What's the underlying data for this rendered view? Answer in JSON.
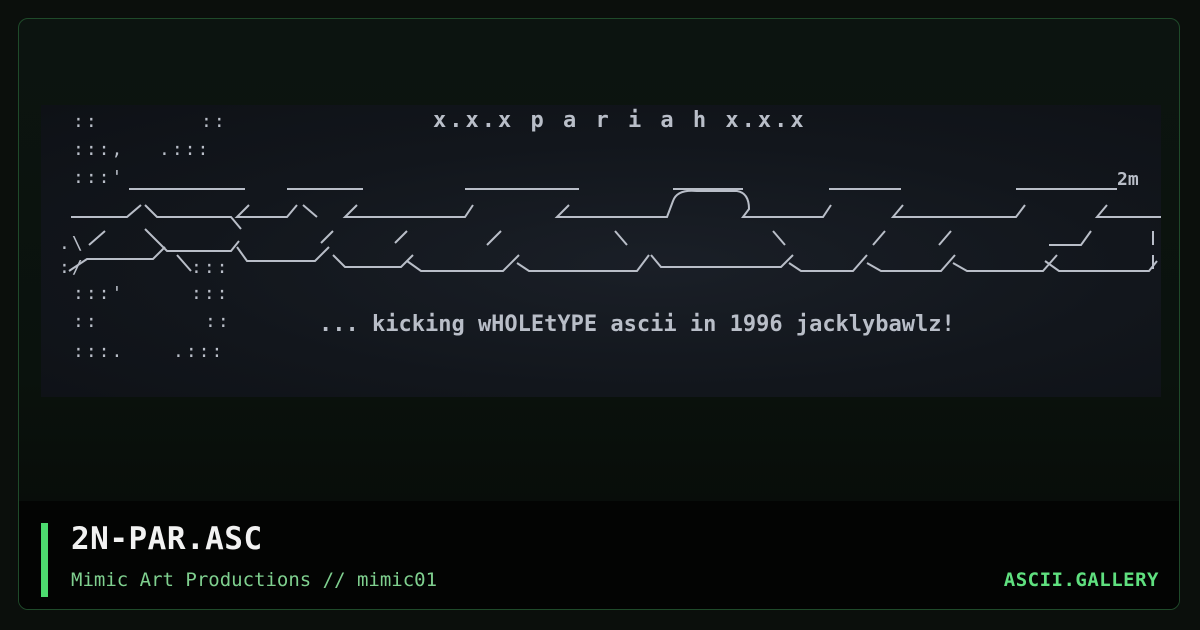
{
  "artwork": {
    "header_text": "x.x.x  p a r i a h  x.x.x",
    "tag_text": "2m",
    "tagline": "... kicking wHOLEtYPE ascii in 1996 jacklybawlz!"
  },
  "footer": {
    "title": "2N-PAR.ASC",
    "subtitle": "Mimic Art Productions // mimic01",
    "site": "ASCII.GALLERY"
  },
  "colors": {
    "accent": "#4ddb6f",
    "site": "#5fe07f",
    "subtitle": "#7fd08f",
    "art_text": "#b9bec8",
    "art_background": "#12161c"
  }
}
